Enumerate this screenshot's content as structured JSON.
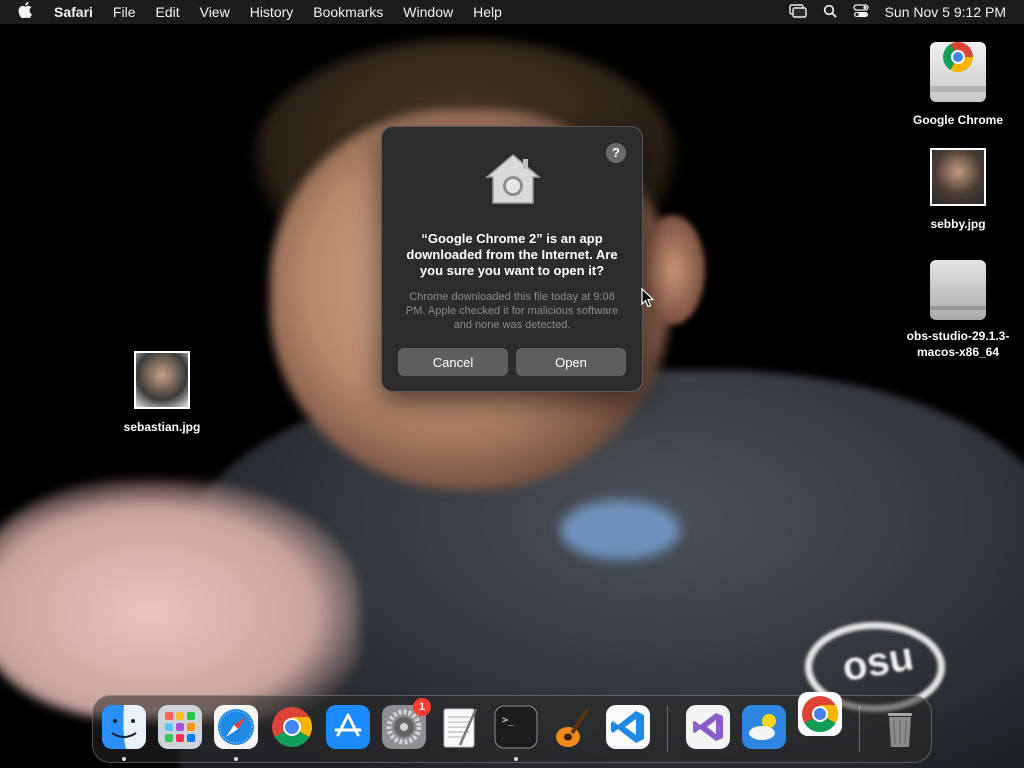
{
  "menubar": {
    "apple_icon": "apple-icon",
    "app_name": "Safari",
    "menus": [
      "File",
      "Edit",
      "View",
      "History",
      "Bookmarks",
      "Window",
      "Help"
    ],
    "status_icons": [
      "screen-mirroring-icon",
      "spotlight-search-icon",
      "control-center-icon"
    ],
    "clock": "Sun Nov 5  9:12 PM"
  },
  "desktop": {
    "icons": [
      {
        "label": "Google Chrome",
        "icon": "chrome-disk-image-icon"
      },
      {
        "label": "sebby.jpg",
        "icon": "image-thumbnail"
      },
      {
        "label": "obs-studio-29.1.3-macos-x86_64",
        "icon": "disk-image-icon"
      },
      {
        "label": "sebastian.jpg",
        "icon": "image-thumbnail"
      }
    ]
  },
  "dialog": {
    "icon": "gatekeeper-house-icon",
    "help_label": "?",
    "title": "“Google Chrome 2” is an app downloaded from the Internet. Are you sure you want to open it?",
    "message": "Chrome downloaded this file today at 9:08 PM. Apple checked it for malicious software and none was detected.",
    "cancel_label": "Cancel",
    "open_label": "Open"
  },
  "dock": {
    "apps": [
      {
        "name": "Finder",
        "icon": "finder-icon",
        "running": true
      },
      {
        "name": "Launchpad",
        "icon": "launchpad-icon",
        "running": false
      },
      {
        "name": "Safari",
        "icon": "safari-icon",
        "running": true
      },
      {
        "name": "Google Chrome",
        "icon": "chrome-icon",
        "running": false
      },
      {
        "name": "App Store",
        "icon": "app-store-icon",
        "running": false
      },
      {
        "name": "System Settings",
        "icon": "system-settings-icon",
        "running": false,
        "badge": "1"
      },
      {
        "name": "TextEdit",
        "icon": "textedit-icon",
        "running": false
      },
      {
        "name": "Terminal",
        "icon": "terminal-icon",
        "running": true
      },
      {
        "name": "GarageBand",
        "icon": "garageband-icon",
        "running": false
      },
      {
        "name": "Visual Studio Code",
        "icon": "vscode-icon",
        "running": false
      },
      {
        "name": "Visual Studio",
        "icon": "visual-studio-icon",
        "running": false
      },
      {
        "name": "Weather",
        "icon": "weather-icon",
        "running": false
      },
      {
        "name": "Google Chrome 2",
        "icon": "chrome-icon",
        "running": false
      },
      {
        "name": "Trash",
        "icon": "trash-icon",
        "running": false
      }
    ]
  },
  "colors": {
    "menubar_bg": "#1e1e1e",
    "dialog_bg": "#2c2c2d",
    "button_bg": "#5f5f61",
    "badge_red": "#ff3b30"
  }
}
